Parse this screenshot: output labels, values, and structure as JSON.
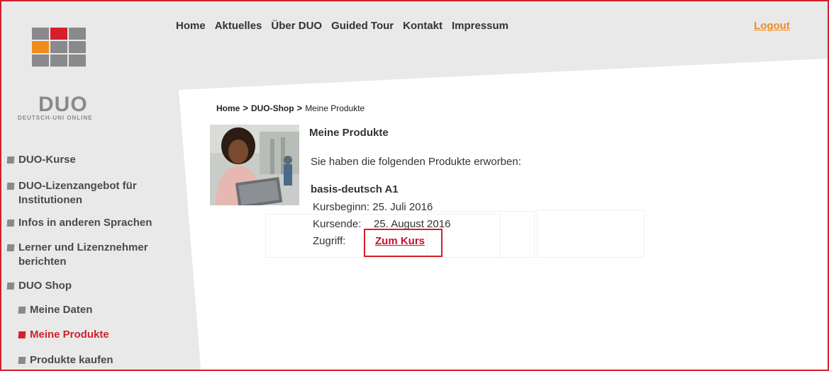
{
  "nav": {
    "items": [
      "Home",
      "Aktuelles",
      "Über DUO",
      "Guided Tour",
      "Kontakt",
      "Impressum"
    ],
    "logout": "Logout"
  },
  "logo": {
    "word": "DUO",
    "subtitle": "DEUTSCH-UNI ONLINE",
    "colors": {
      "grey": "#8a8a8c",
      "red": "#d3202a",
      "orange": "#f08c1c"
    }
  },
  "sidebar": {
    "items": [
      {
        "label": "DUO-Kurse",
        "active": false
      },
      {
        "label": "DUO-Lizenzangebot für Institutionen",
        "active": false
      },
      {
        "label": "Infos in anderen Sprachen",
        "active": false
      },
      {
        "label": "Lerner und Lizenznehmer berichten",
        "active": false
      },
      {
        "label": "DUO Shop",
        "active": false
      },
      {
        "label": "Meine Daten",
        "active": false
      },
      {
        "label": "Meine Produkte",
        "active": true
      },
      {
        "label": "Produkte kaufen",
        "active": false
      }
    ]
  },
  "breadcrumb": {
    "home": "Home",
    "sep": ">",
    "shop": "DUO-Shop",
    "current": "Meine Produkte"
  },
  "main": {
    "title": "Meine Produkte",
    "intro": "Sie haben die folgenden Produkte erworben:",
    "product": {
      "name": "basis-deutsch A1",
      "start_label": "Kursbeginn:",
      "start_value": "25. Juli 2016",
      "end_label": "Kursende:",
      "end_value": "25. August 2016",
      "access_label": "Zugriff:",
      "access_link": "Zum Kurs"
    }
  },
  "accent_color": "#d3202a"
}
